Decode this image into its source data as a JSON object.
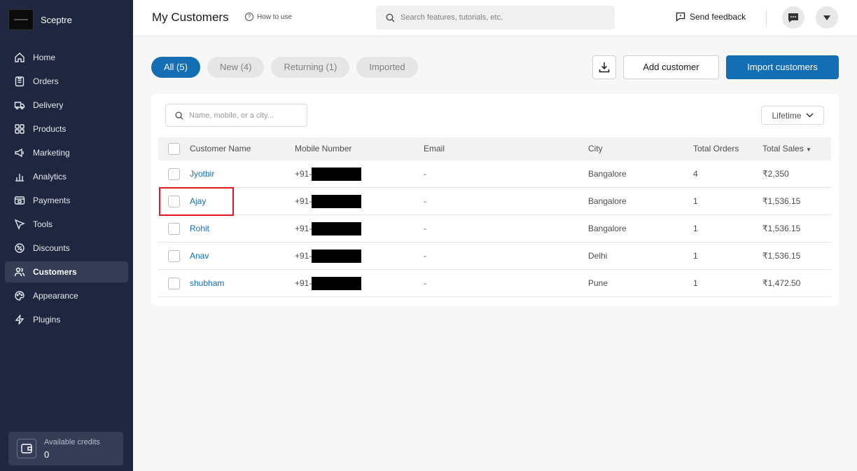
{
  "sidebar": {
    "brand": "Sceptre",
    "items": [
      {
        "label": "Home",
        "icon": "home-icon"
      },
      {
        "label": "Orders",
        "icon": "orders-icon"
      },
      {
        "label": "Delivery",
        "icon": "truck-icon"
      },
      {
        "label": "Products",
        "icon": "grid-icon"
      },
      {
        "label": "Marketing",
        "icon": "megaphone-icon"
      },
      {
        "label": "Analytics",
        "icon": "chart-icon"
      },
      {
        "label": "Payments",
        "icon": "wallet-icon"
      },
      {
        "label": "Tools",
        "icon": "cursor-icon"
      },
      {
        "label": "Discounts",
        "icon": "discount-icon"
      },
      {
        "label": "Customers",
        "icon": "users-icon",
        "active": true
      },
      {
        "label": "Appearance",
        "icon": "palette-icon"
      },
      {
        "label": "Plugins",
        "icon": "bolt-icon"
      }
    ],
    "credits": {
      "label": "Available credits",
      "value": "0"
    }
  },
  "header": {
    "title": "My Customers",
    "how_to": "How to use",
    "search_placeholder": "Search features, tutorials, etc.",
    "feedback": "Send feedback"
  },
  "filters": {
    "tabs": [
      {
        "label": "All (5)",
        "active": true
      },
      {
        "label": "New (4)"
      },
      {
        "label": "Returning (1)"
      },
      {
        "label": "Imported"
      }
    ]
  },
  "actions": {
    "add_customer": "Add customer",
    "import_customers": "Import customers"
  },
  "table": {
    "search_placeholder": "Name, mobile, or a city...",
    "period": "Lifetime",
    "columns": [
      "Customer Name",
      "Mobile Number",
      "Email",
      "City",
      "Total Orders",
      "Total Sales"
    ],
    "rows": [
      {
        "name": "Jyotbir",
        "mobile": "+91-",
        "email": "-",
        "city": "Bangalore",
        "orders": "4",
        "sales": "₹2,350"
      },
      {
        "name": "Ajay",
        "mobile": "+91-",
        "email": "-",
        "city": "Bangalore",
        "orders": "1",
        "sales": "₹1,536.15"
      },
      {
        "name": "Rohit",
        "mobile": "+91-",
        "email": "-",
        "city": "Bangalore",
        "orders": "1",
        "sales": "₹1,536.15"
      },
      {
        "name": "Anav",
        "mobile": "+91-",
        "email": "-",
        "city": "Delhi",
        "orders": "1",
        "sales": "₹1,536.15"
      },
      {
        "name": "shubham",
        "mobile": "+91-",
        "email": "-",
        "city": "Pune",
        "orders": "1",
        "sales": "₹1,472.50"
      }
    ]
  },
  "colors": {
    "sidebar_bg": "#1e2640",
    "accent": "#146eb4",
    "highlight": "#e5181f"
  }
}
